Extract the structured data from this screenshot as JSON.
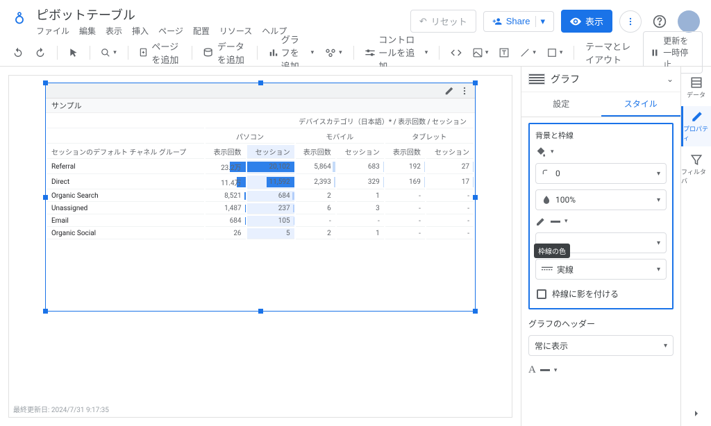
{
  "header": {
    "doc_title": "ピボットテーブル",
    "menu": [
      "ファイル",
      "編集",
      "表示",
      "挿入",
      "ページ",
      "配置",
      "リソース",
      "ヘルプ"
    ],
    "reset": "リセット",
    "share": "Share",
    "view": "表示"
  },
  "toolbar": {
    "add_page": "ページを追加",
    "add_data": "データを追加",
    "add_chart": "グラフを追加",
    "add_control": "コントロールを追加",
    "theme_layout": "テーマとレイアウト",
    "pause": "更新を一時停止"
  },
  "chart": {
    "sample_label": "サンプル",
    "super_title": "デバイスカテゴリ（日本語）* / 表示回数 / セッション",
    "dim_header": "セッションのデフォルト チャネル グループ",
    "device_groups": [
      "パソコン",
      "モバイル",
      "タブレット"
    ],
    "metric_headers": [
      "表示回数",
      "セッション",
      "表示回数",
      "セッション",
      "表示回数",
      "セッション"
    ],
    "rows": [
      {
        "label": "Referral",
        "v": [
          "23.2万",
          "20,102",
          "5,864",
          "683",
          "192",
          "27"
        ]
      },
      {
        "label": "Direct",
        "v": [
          "11.4万",
          "11,592",
          "2,393",
          "329",
          "169",
          "17"
        ]
      },
      {
        "label": "Organic Search",
        "v": [
          "8,521",
          "684",
          "2",
          "1",
          "-",
          "-"
        ]
      },
      {
        "label": "Unassigned",
        "v": [
          "1,487",
          "237",
          "6",
          "3",
          "-",
          "-"
        ]
      },
      {
        "label": "Email",
        "v": [
          "684",
          "105",
          "-",
          "-",
          "-",
          "-"
        ]
      },
      {
        "label": "Organic Social",
        "v": [
          "26",
          "5",
          "2",
          "1",
          "-",
          "-"
        ]
      }
    ],
    "footer_ts": "最終更新日: 2024/7/31 9:17:35"
  },
  "panel": {
    "chart_label": "グラフ",
    "tab_setup": "設定",
    "tab_style": "スタイル",
    "bg_border_title": "背景と枠線",
    "border_radius": "0",
    "opacity": "100%",
    "tooltip": "枠線の色",
    "line_style": "実線",
    "shadow_label": "枠線に影を付ける",
    "chart_header_title": "グラフのヘッダー",
    "header_mode": "常に表示"
  },
  "rail": {
    "data": "データ",
    "properties": "プロパティ",
    "filterbar": "フィルタバ"
  }
}
